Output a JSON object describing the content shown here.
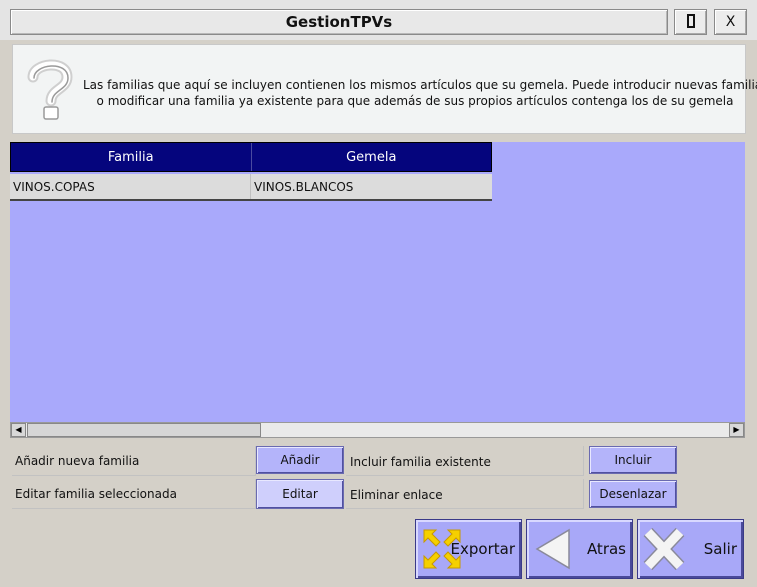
{
  "window": {
    "title": "GestionTPVs",
    "maximize_icon": "maximize-icon",
    "close_label": "X"
  },
  "info": {
    "icon": "question-mark-icon",
    "line1": "Las familias que aquí se incluyen contienen los mismos artículos que su gemela. Puede introducir nuevas familias",
    "line2": "o modificar una familia ya existente para que  además de sus propios artículos contenga los de su gemela"
  },
  "grid": {
    "columns": [
      "Familia",
      "Gemela"
    ],
    "rows": [
      [
        "VINOS.COPAS",
        "VINOS.BLANCOS"
      ]
    ]
  },
  "actions": {
    "add_label": "Añadir nueva familia",
    "add_button": "Añadir",
    "include_label": "Incluir familia existente",
    "include_button": "Incluir",
    "edit_label": "Editar familia seleccionada",
    "edit_button": "Editar",
    "remove_label": "Eliminar enlace",
    "remove_button": "Desenlazar"
  },
  "footer": {
    "export_label": "Exportar",
    "back_label": "Atras",
    "exit_label": "Salir"
  },
  "colors": {
    "grid_background": "#a9a9fb",
    "header_background": "#05057d",
    "button_background": "#b4b4fa"
  }
}
